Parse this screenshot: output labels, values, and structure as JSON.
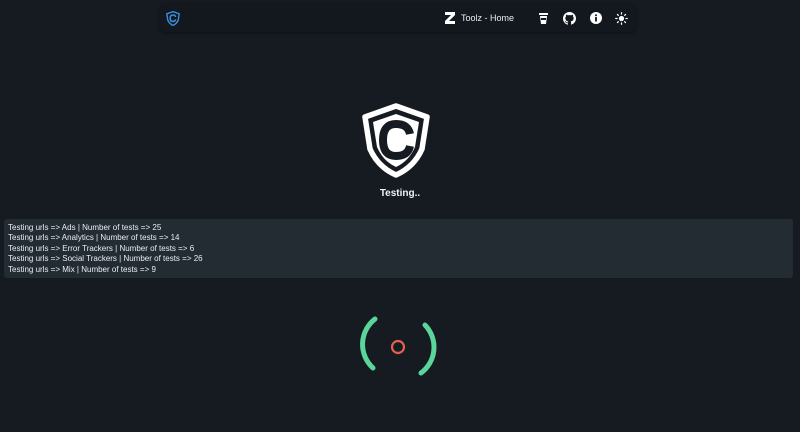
{
  "nav": {
    "home_label": "Toolz - Home",
    "icons": [
      "coffee-icon",
      "github-icon",
      "info-icon",
      "sun-icon"
    ]
  },
  "status": {
    "text": "Testing.."
  },
  "log": {
    "lines": [
      "Testing urls => Ads | Number of tests => 25",
      "Testing urls => Analytics | Number of tests => 14",
      "Testing urls => Error Trackers | Number of tests => 6",
      "Testing urls => Social Trackers | Number of tests => 26",
      "Testing urls => Mix | Number of tests => 9"
    ]
  },
  "colors": {
    "background": "#161b22",
    "navbar": "#13181f",
    "log_panel": "#232b33",
    "accent_blue": "#3b8ed9",
    "spinner_green": "#5ad69a",
    "spinner_red": "#e2604f"
  }
}
